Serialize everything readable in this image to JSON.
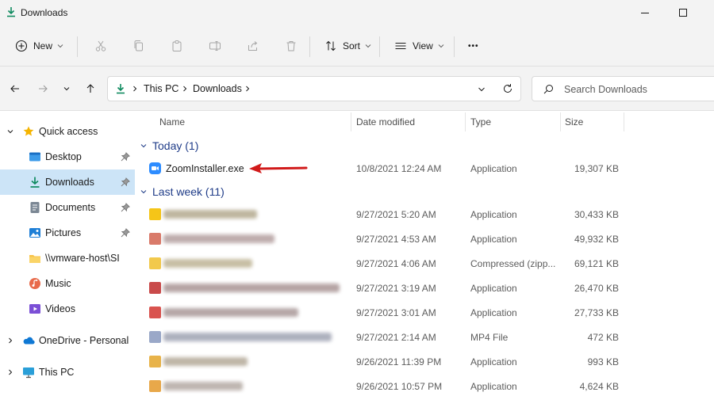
{
  "window": {
    "title": "Downloads"
  },
  "toolbar": {
    "new_label": "New",
    "sort_label": "Sort",
    "view_label": "View",
    "more_label": "•••"
  },
  "address": {
    "crumbs": [
      "This PC",
      "Downloads"
    ],
    "search_placeholder": "Search Downloads"
  },
  "sidebar": {
    "items": [
      {
        "label": "Quick access",
        "icon": "star-icon"
      },
      {
        "label": "Desktop",
        "icon": "desktop-icon"
      },
      {
        "label": "Downloads",
        "icon": "download-icon"
      },
      {
        "label": "Documents",
        "icon": "documents-icon"
      },
      {
        "label": "Pictures",
        "icon": "pictures-icon"
      },
      {
        "label": "\\\\vmware-host\\SI",
        "icon": "network-folder-icon"
      },
      {
        "label": "Music",
        "icon": "music-icon"
      },
      {
        "label": "Videos",
        "icon": "videos-icon"
      },
      {
        "label": "OneDrive - Personal",
        "icon": "onedrive-icon"
      },
      {
        "label": "This PC",
        "icon": "computer-icon"
      }
    ]
  },
  "columns": {
    "name": "Name",
    "date": "Date modified",
    "type": "Type",
    "size": "Size"
  },
  "groups": {
    "today": {
      "label": "Today (1)"
    },
    "last_week": {
      "label": "Last week (11)"
    }
  },
  "files": {
    "today": [
      {
        "name": "ZoomInstaller.exe",
        "date": "10/8/2021 12:24 AM",
        "type": "Application",
        "size": "19,307 KB"
      }
    ],
    "last_week": [
      {
        "date": "9/27/2021 5:20 AM",
        "type": "Application",
        "size": "30,433 KB"
      },
      {
        "date": "9/27/2021 4:53 AM",
        "type": "Application",
        "size": "49,932 KB"
      },
      {
        "date": "9/27/2021 4:06 AM",
        "type": "Compressed (zipp...",
        "size": "69,121 KB"
      },
      {
        "date": "9/27/2021 3:19 AM",
        "type": "Application",
        "size": "26,470 KB"
      },
      {
        "date": "9/27/2021 3:01 AM",
        "type": "Application",
        "size": "27,733 KB"
      },
      {
        "date": "9/27/2021 2:14 AM",
        "type": "MP4 File",
        "size": "472 KB"
      },
      {
        "date": "9/26/2021 11:39 PM",
        "type": "Application",
        "size": "993 KB"
      },
      {
        "date": "9/26/2021 10:57 PM",
        "type": "Application",
        "size": "4,624 KB"
      }
    ]
  },
  "colors": {
    "accent": "#0067c0",
    "selection": "#cce4f7",
    "group_header": "#1f3c88",
    "annotation_arrow": "#d11a1a"
  }
}
